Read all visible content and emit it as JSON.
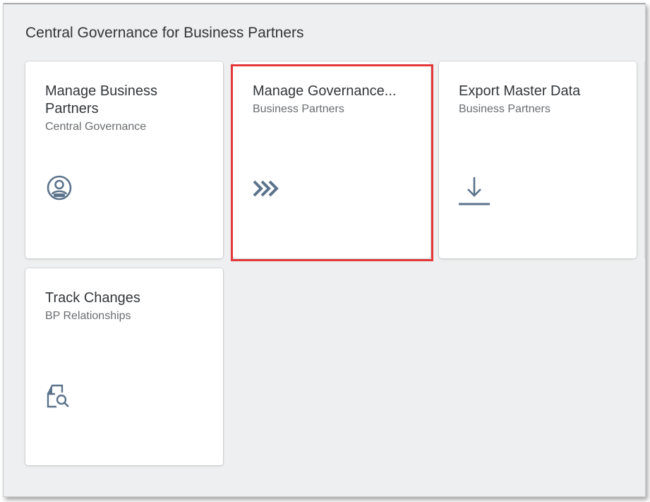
{
  "group": {
    "title": "Central Governance for Business Partners"
  },
  "tiles": [
    {
      "title": "Manage Business Partners",
      "subtitle": "Central Governance",
      "icon": "user-avatar-icon"
    },
    {
      "title": "Manage Governance...",
      "subtitle": "Business Partners",
      "icon": "process-chevrons-icon"
    },
    {
      "title": "Export Master Data",
      "subtitle": "Business Partners",
      "icon": "download-icon"
    },
    {
      "title": "Track Changes",
      "subtitle": "BP Relationships",
      "icon": "document-search-icon"
    }
  ],
  "colors": {
    "accent": "#5b738b",
    "background": "#edeff0",
    "highlight": "#e4383b"
  }
}
